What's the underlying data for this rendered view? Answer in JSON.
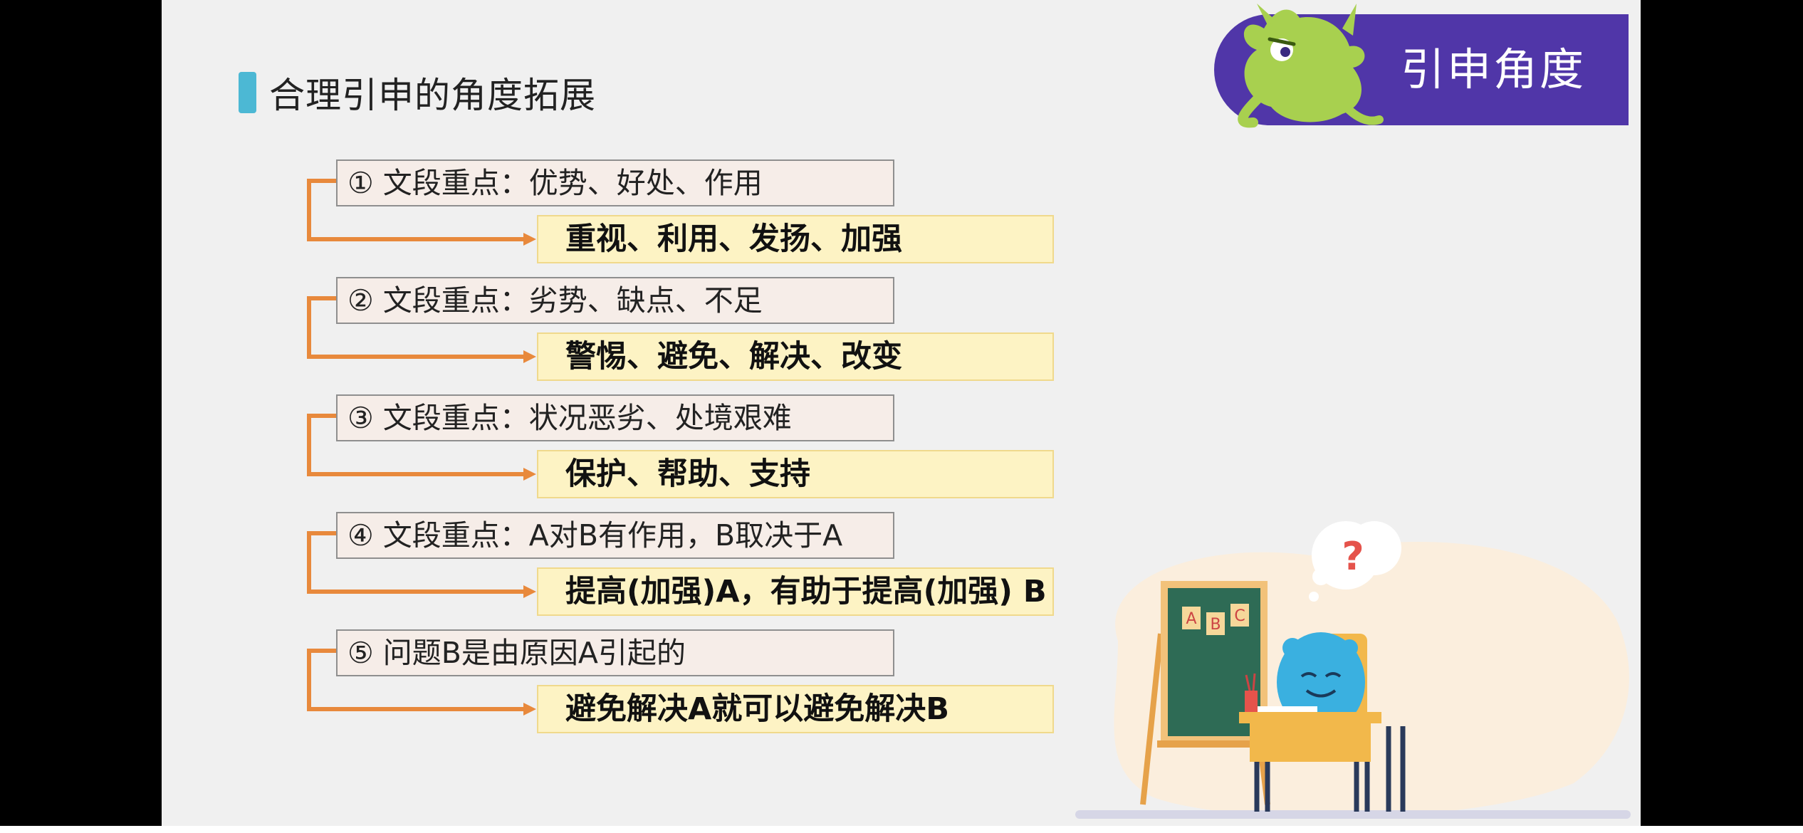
{
  "slide": {
    "title": "合理引申的角度拓展",
    "corner_label": "引申角度",
    "items": [
      {
        "key": "① 文段重点：优势、好处、作用",
        "result": "重视、利用、发扬、加强"
      },
      {
        "key": "② 文段重点：劣势、缺点、不足",
        "result": "警惕、避免、解决、改变"
      },
      {
        "key": "③ 文段重点：状况恶劣、处境艰难",
        "result": "保护、帮助、支持"
      },
      {
        "key": "④ 文段重点：A对B有作用，B取决于A",
        "result": "提高(加强)A，有助于提高(加强) B"
      },
      {
        "key": "⑤ 问题B是由原因A引起的",
        "result": "避免解决A就可以避免解决B"
      }
    ],
    "blackboard_letters": [
      "A",
      "B",
      "C"
    ],
    "thought_mark": "?"
  },
  "colors": {
    "accent_blue": "#4cb8d4",
    "banner_purple": "#5036a8",
    "arrow_orange": "#e8893c",
    "result_fill": "#fdf3c4",
    "key_fill": "#f6ede8"
  }
}
